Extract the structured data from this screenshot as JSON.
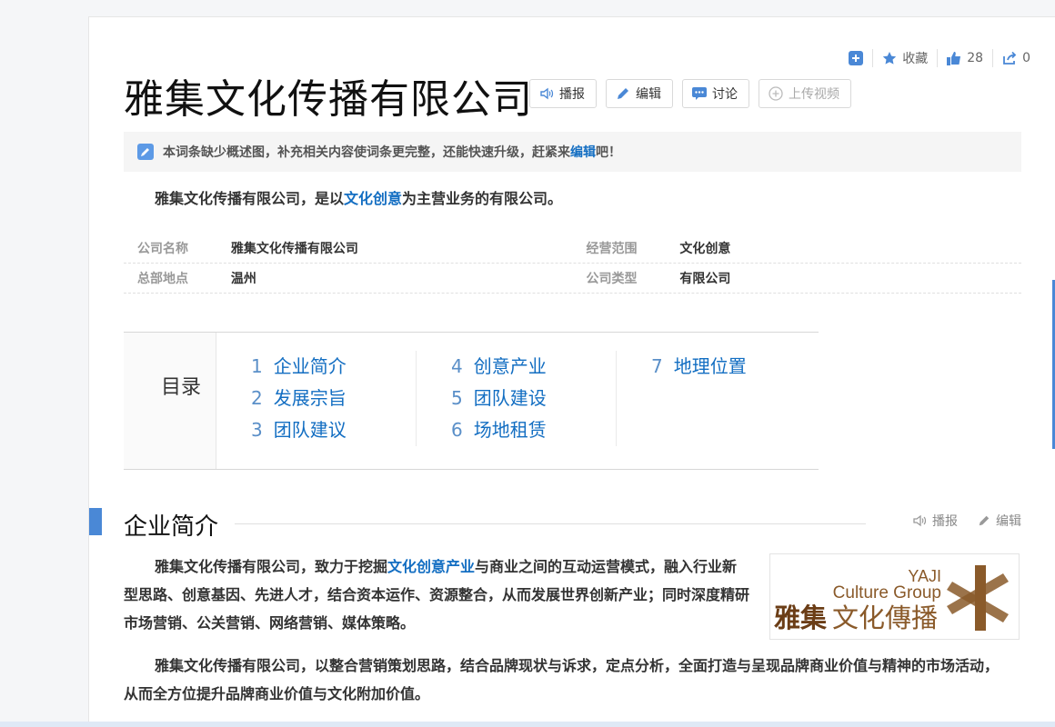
{
  "top_actions": {
    "collect_label": "收藏",
    "like_count": "28",
    "share_count": "0"
  },
  "title": "雅集文化传播有限公司",
  "title_buttons": {
    "broadcast": "播报",
    "edit": "编辑",
    "discuss": "讨论",
    "upload_video": "上传视频"
  },
  "notice": {
    "text_before": "本词条缺少概述图，补充相关内容使词条更完整，还能快速升级，赶紧来",
    "link": "编辑",
    "text_after": "吧！"
  },
  "summary": {
    "before": "雅集文化传播有限公司，是以",
    "link": "文化创意",
    "after": "为主营业务的有限公司。"
  },
  "info": {
    "rows": [
      {
        "k1": "公司名称",
        "v1": "雅集文化传播有限公司",
        "k2": "经营范围",
        "v2": "文化创意"
      },
      {
        "k1": "总部地点",
        "v1": "温州",
        "k2": "公司类型",
        "v2": "有限公司"
      }
    ]
  },
  "catalog": {
    "title": "目录",
    "items": [
      {
        "num": "1",
        "label": "企业简介"
      },
      {
        "num": "2",
        "label": "发展宗旨"
      },
      {
        "num": "3",
        "label": "团队建议"
      },
      {
        "num": "4",
        "label": "创意产业"
      },
      {
        "num": "5",
        "label": "团队建设"
      },
      {
        "num": "6",
        "label": "场地租赁"
      },
      {
        "num": "7",
        "label": "地理位置"
      }
    ]
  },
  "section": {
    "title": "企业简介",
    "broadcast": "播报",
    "edit": "编辑"
  },
  "para1": {
    "before": "雅集文化传播有限公司，致力于挖掘",
    "link": "文化创意产业",
    "after": "与商业之间的互动运营模式，融入行业新型思路、创意基因、先进人才，结合资本运作、资源整合，从而发展世界创新产业；同时深度精研市场营销、公关营销、网络营销、媒体策略。"
  },
  "para2": "雅集文化传播有限公司，以整合营销策划思路，结合品牌现状与诉求，定点分析，全面打造与呈现品牌商业价值与精神的市场活动，从而全方位提升品牌商业价值与文化附加价值。",
  "logo": {
    "yaji": "YAJI",
    "culture_group": "Culture Group",
    "cn_left": "雅集",
    "cn_right": "文化傳播"
  },
  "colors": {
    "link": "#136ec2",
    "accent": "#4a88d6",
    "logo_brown": "#8a5a2a"
  }
}
